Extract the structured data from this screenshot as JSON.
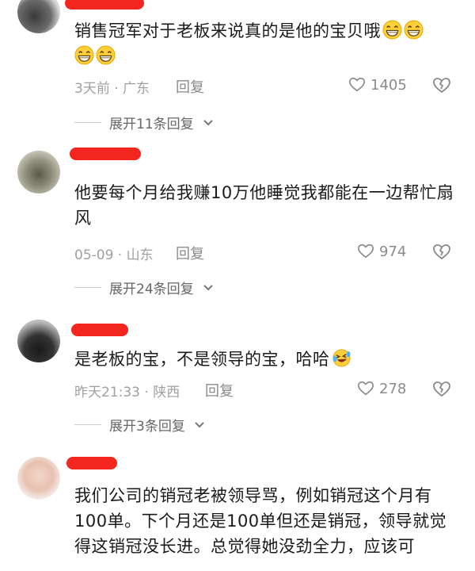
{
  "comments": [
    {
      "text": "销售冠军对于老板来说真的是他的宝贝哦",
      "emoji_count": 4,
      "time": "3天前 · 广东",
      "reply_label": "回复",
      "likes": "1405",
      "expand_label": "展开11条回复"
    },
    {
      "text": "他要每个月给我赚10万他睡觉我都能在一边帮忙扇风",
      "time": "05-09 · 山东",
      "reply_label": "回复",
      "likes": "974",
      "expand_label": "展开24条回复"
    },
    {
      "text": "是老板的宝，不是领导的宝，哈哈",
      "time": "昨天21:33 · 陕西",
      "reply_label": "回复",
      "likes": "278",
      "expand_label": "展开3条回复"
    },
    {
      "text": "我们公司的销冠老被领导骂，例如销冠这个月有100单。下个月还是100单但还是销冠，领导就觉得这销冠没长进。总觉得她没劲全力，应该可"
    }
  ],
  "colors": {
    "redaction": "#f2261f",
    "meta": "#a0a0a0"
  },
  "icons": [
    "heart-outline-icon",
    "broken-heart-icon",
    "chevron-down-icon",
    "grin-emoji-icon",
    "laugh-tears-emoji-icon"
  ]
}
